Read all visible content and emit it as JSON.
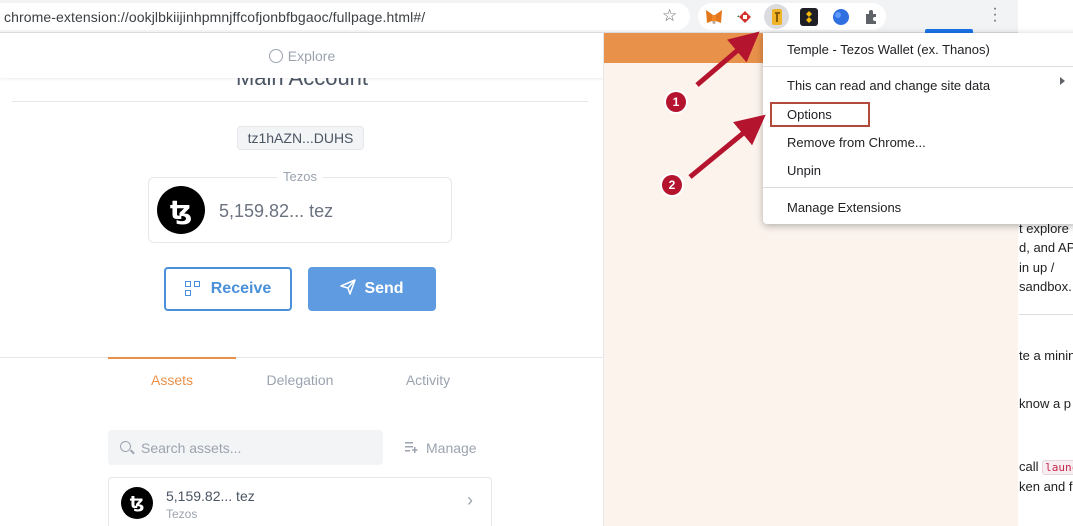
{
  "browser": {
    "url": "chrome-extension://ookjlbkiijinhpmnjffcofjonbfbgaoc/fullpage.html#/",
    "extensions": [
      "metamask-icon",
      "red-diamond-icon",
      "temple-wallet-icon",
      "binance-icon",
      "blue-globe-icon",
      "puzzle-icon"
    ]
  },
  "wallet": {
    "explore_label": "Explore",
    "account_title": "Main Account",
    "address": "tz1hAZN...DUHS",
    "balance_legend": "Tezos",
    "balance_amount": "5,159.82... tez",
    "receive_label": "Receive",
    "send_label": "Send",
    "tabs": [
      {
        "label": "Assets",
        "active": true
      },
      {
        "label": "Delegation",
        "active": false
      },
      {
        "label": "Activity",
        "active": false
      }
    ],
    "search_placeholder": "Search assets...",
    "manage_label": "Manage",
    "asset": {
      "amount": "5,159.82... tez",
      "name": "Tezos"
    }
  },
  "context_menu": {
    "items": [
      "Temple - Tezos Wallet (ex. Thanos)",
      "This can read and change site data",
      "Options",
      "Remove from Chrome...",
      "Unpin",
      "Manage Extensions"
    ]
  },
  "annotations": [
    "1",
    "2"
  ],
  "right_page_fragments": [
    "t explore",
    "d, and AP",
    "in up /",
    "sandbox.",
    "te a minin",
    "know a p",
    "call",
    "launc",
    "ken and f"
  ],
  "colors": {
    "accent_orange": "#e8914a",
    "accent_blue": "#4a90d9",
    "annotation_red": "#b5142f"
  }
}
